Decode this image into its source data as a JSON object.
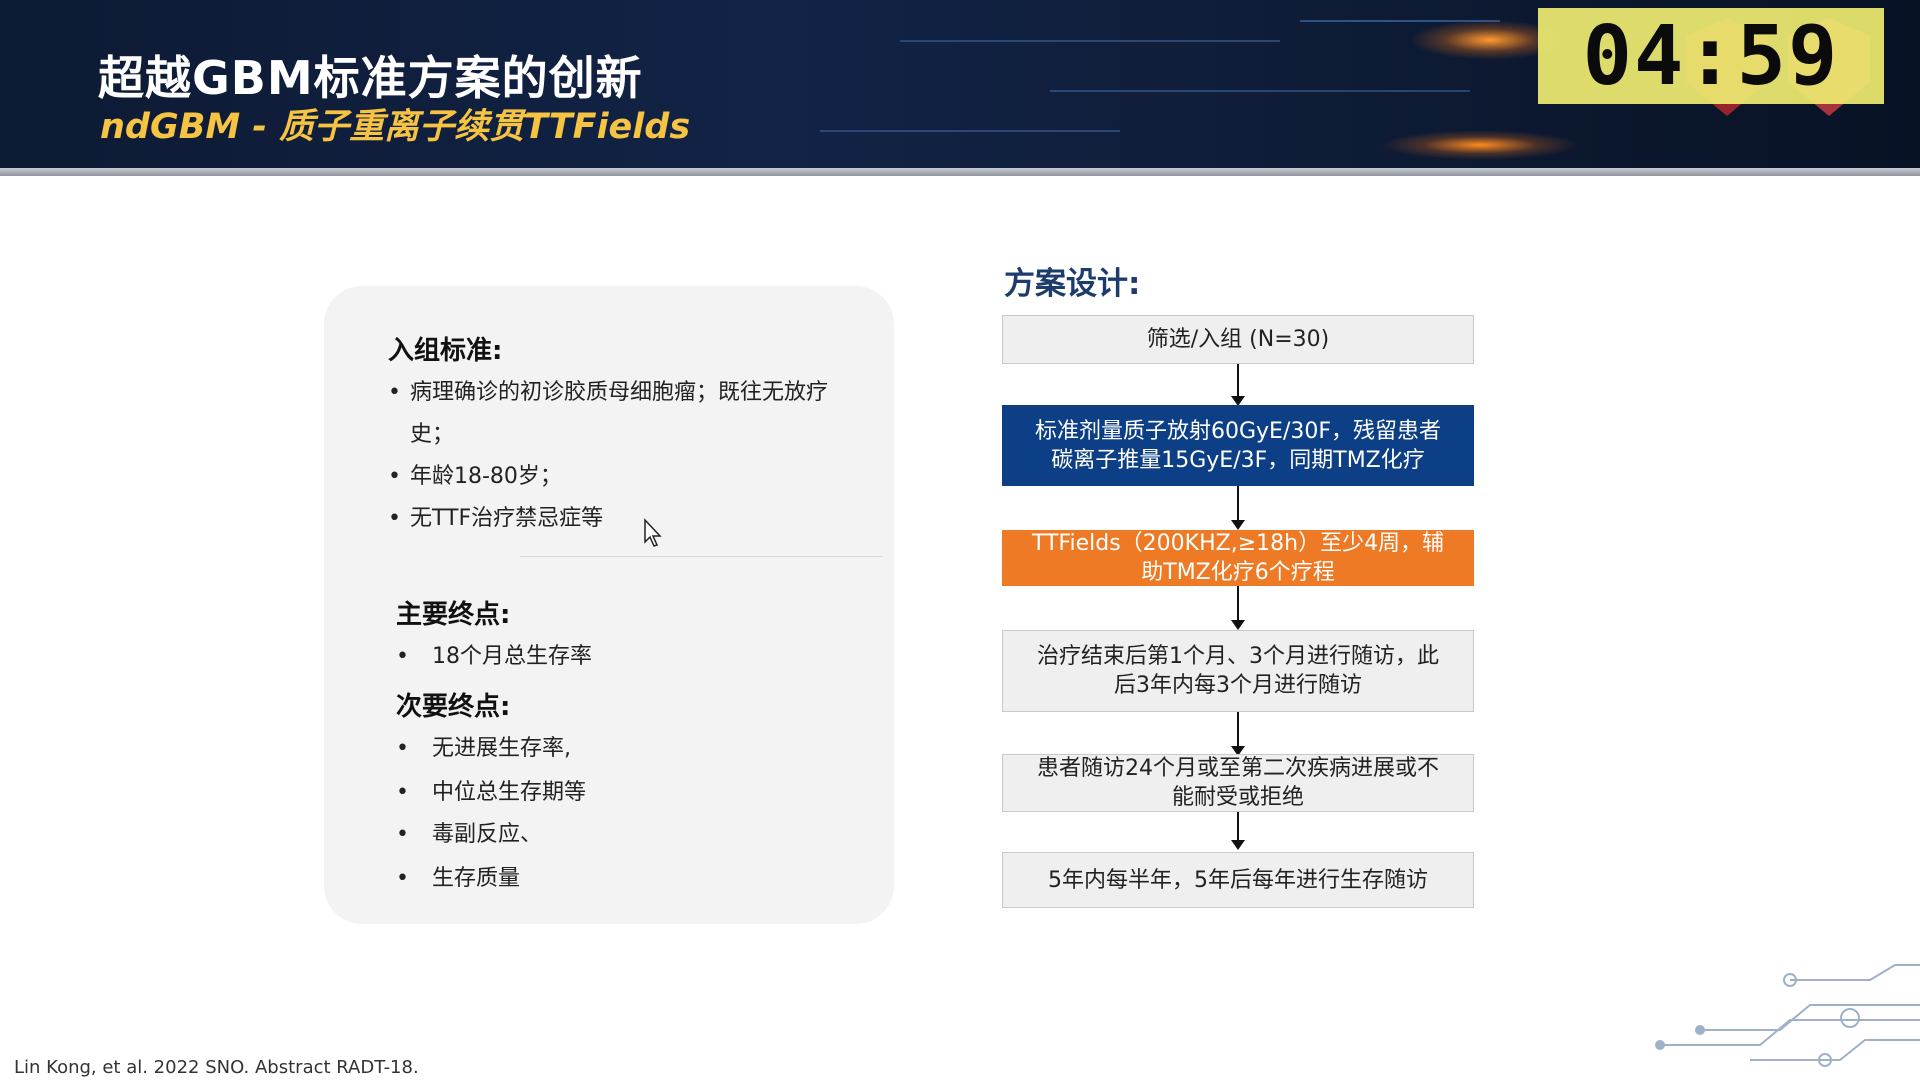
{
  "header": {
    "title": "超越GBM标准方案的创新",
    "subtitle": "ndGBM - 质子重离子续贯TTFields",
    "timer": "04:59"
  },
  "left_card": {
    "inclusion": {
      "title": "入组标准:",
      "items": [
        "病理确诊的初诊胶质母细胞瘤；既往无放疗",
        "史；",
        "年龄18-80岁；",
        "无TTF治疗禁忌症等"
      ]
    },
    "primary": {
      "title": "主要终点:",
      "items": [
        "18个月总生存率"
      ]
    },
    "secondary": {
      "title": "次要终点:",
      "items": [
        "无进展生存率,",
        "中位总生存期等",
        "毒副反应、",
        "生存质量"
      ]
    }
  },
  "scheme": {
    "title": "方案设计:",
    "steps": [
      {
        "line1": "筛选/入组 (N=30)",
        "line2": ""
      },
      {
        "line1": "标准剂量质子放射60GyE/30F，残留患者",
        "line2": "碳离子推量15GyE/3F，同期TMZ化疗"
      },
      {
        "line1": "TTFields（200KHZ,≥18h）至少4周，辅",
        "line2": "助TMZ化疗6个疗程"
      },
      {
        "line1": "治疗结束后第1个月、3个月进行随访，此",
        "line2": "后3年内每3个月进行随访"
      },
      {
        "line1": "患者随访24个月或至第二次疾病进展或不",
        "line2": "能耐受或拒绝"
      },
      {
        "line1": "5年内每半年，5年后每年进行生存随访",
        "line2": ""
      }
    ]
  },
  "footer": {
    "citation": "Lin Kong, et al. 2022 SNO. Abstract RADT-18."
  },
  "colors": {
    "banner": "#122346",
    "subtitle": "#f6c342",
    "timer_bg": "#edeb70",
    "step_blue": "#0d3f86",
    "step_orange": "#ee7a25"
  }
}
